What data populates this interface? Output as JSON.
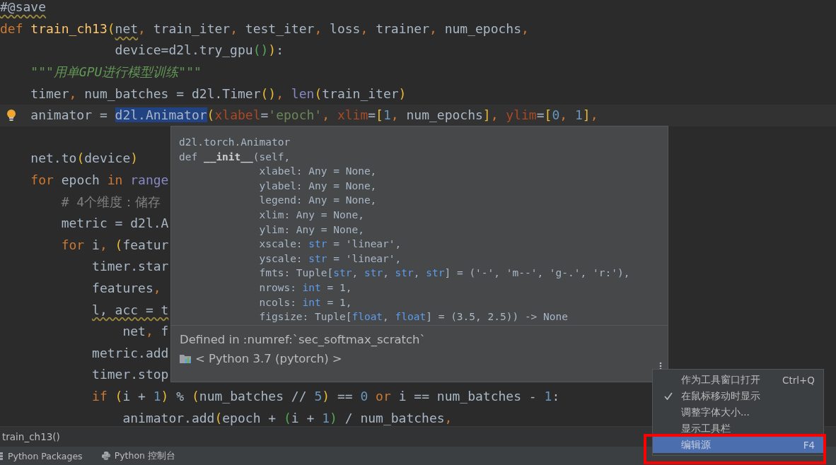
{
  "editor": {
    "lines": [
      {
        "current": false,
        "tokens": [
          {
            "kind": "w",
            "text": "#@save"
          }
        ]
      },
      {
        "current": false,
        "tokens": [
          {
            "kind": "kw",
            "text": "def "
          },
          {
            "kind": "fn",
            "text": "train_ch13"
          },
          {
            "kind": "y",
            "text": "("
          },
          {
            "kind": "w",
            "text": "net"
          },
          {
            "kind": "kw",
            "text": ", "
          },
          {
            "kind": "p",
            "text": "train_iter"
          },
          {
            "kind": "kw",
            "text": ", "
          },
          {
            "kind": "p",
            "text": "test_iter"
          },
          {
            "kind": "kw",
            "text": ", "
          },
          {
            "kind": "p",
            "text": "loss"
          },
          {
            "kind": "kw",
            "text": ", "
          },
          {
            "kind": "p",
            "text": "trainer"
          },
          {
            "kind": "kw",
            "text": ", "
          },
          {
            "kind": "p",
            "text": "num_epochs"
          },
          {
            "kind": "kw",
            "text": ","
          }
        ]
      },
      {
        "current": false,
        "tokens": [
          {
            "kind": "p",
            "text": "               device=d2l.try_gpu"
          },
          {
            "kind": "g",
            "text": "("
          },
          {
            "kind": "g",
            "text": ")"
          },
          {
            "kind": "y",
            "text": ")"
          },
          {
            "kind": "p",
            "text": ":"
          }
        ]
      },
      {
        "current": false,
        "tokens": [
          {
            "kind": "d",
            "text": "    \"\"\"用单GPU进行模型训练\"\"\""
          }
        ]
      },
      {
        "current": false,
        "tokens": [
          {
            "kind": "p",
            "text": "    timer"
          },
          {
            "kind": "kw",
            "text": ", "
          },
          {
            "kind": "p",
            "text": "num_batches = d2l.Timer"
          },
          {
            "kind": "y",
            "text": "()"
          },
          {
            "kind": "kw",
            "text": ", "
          },
          {
            "kind": "b",
            "text": "len"
          },
          {
            "kind": "y",
            "text": "("
          },
          {
            "kind": "p",
            "text": "train_iter"
          },
          {
            "kind": "y",
            "text": ")"
          }
        ]
      },
      {
        "current": true,
        "tokens": [
          {
            "kind": "p",
            "text": "    animator = "
          },
          {
            "kind": "sel",
            "text": "d2l.Animator"
          },
          {
            "kind": "y",
            "text": "("
          },
          {
            "kind": "a",
            "text": "xlabel"
          },
          {
            "kind": "p",
            "text": "="
          },
          {
            "kind": "s",
            "text": "'epoch'"
          },
          {
            "kind": "kw",
            "text": ", "
          },
          {
            "kind": "a",
            "text": "xlim"
          },
          {
            "kind": "p",
            "text": "="
          },
          {
            "kind": "y",
            "text": "["
          },
          {
            "kind": "n",
            "text": "1"
          },
          {
            "kind": "kw",
            "text": ", "
          },
          {
            "kind": "p",
            "text": "num_epochs"
          },
          {
            "kind": "y",
            "text": "]"
          },
          {
            "kind": "kw",
            "text": ", "
          },
          {
            "kind": "a",
            "text": "ylim"
          },
          {
            "kind": "p",
            "text": "="
          },
          {
            "kind": "y",
            "text": "["
          },
          {
            "kind": "n",
            "text": "0"
          },
          {
            "kind": "kw",
            "text": ", "
          },
          {
            "kind": "n",
            "text": "1"
          },
          {
            "kind": "y",
            "text": "]"
          },
          {
            "kind": "kw",
            "text": ","
          }
        ]
      },
      {
        "current": false
      },
      {
        "current": false,
        "tokens": [
          {
            "kind": "p",
            "text": "    net.to"
          },
          {
            "kind": "y",
            "text": "("
          },
          {
            "kind": "p",
            "text": "device"
          },
          {
            "kind": "y",
            "text": ")"
          }
        ]
      },
      {
        "current": false,
        "tokens": [
          {
            "kind": "kw",
            "text": "    for "
          },
          {
            "kind": "p",
            "text": "epoch "
          },
          {
            "kind": "kw",
            "text": "in "
          },
          {
            "kind": "b",
            "text": "range"
          }
        ]
      },
      {
        "current": false,
        "tokens": [
          {
            "kind": "c",
            "text": "        # 4个维度：储存"
          }
        ]
      },
      {
        "current": false,
        "tokens": [
          {
            "kind": "p",
            "text": "        metric = d2l.A"
          }
        ]
      },
      {
        "current": false,
        "tokens": [
          {
            "kind": "kw",
            "text": "        for "
          },
          {
            "kind": "p",
            "text": "i"
          },
          {
            "kind": "kw",
            "text": ", "
          },
          {
            "kind": "y",
            "text": "("
          },
          {
            "kind": "p",
            "text": "featur"
          }
        ]
      },
      {
        "current": false,
        "tokens": [
          {
            "kind": "p",
            "text": "            timer.star"
          }
        ]
      },
      {
        "current": false,
        "tokens": [
          {
            "kind": "p",
            "text": "            features"
          },
          {
            "kind": "kw",
            "text": ","
          }
        ]
      },
      {
        "current": false,
        "tokens": [
          {
            "kind": "w",
            "text": "            l, acc = t"
          }
        ]
      },
      {
        "current": false,
        "tokens": [
          {
            "kind": "p",
            "text": "                net"
          },
          {
            "kind": "kw",
            "text": ", "
          },
          {
            "kind": "p",
            "text": "f"
          }
        ]
      },
      {
        "current": false,
        "tokens": [
          {
            "kind": "p",
            "text": "            metric.add"
          }
        ]
      },
      {
        "current": false,
        "tokens": [
          {
            "kind": "p",
            "text": "            timer.stop"
          }
        ]
      },
      {
        "current": false,
        "tokens": [
          {
            "kind": "kw",
            "text": "            if "
          },
          {
            "kind": "y",
            "text": "("
          },
          {
            "kind": "p",
            "text": "i + "
          },
          {
            "kind": "n",
            "text": "1"
          },
          {
            "kind": "y",
            "text": ")"
          },
          {
            "kind": "p",
            "text": " % "
          },
          {
            "kind": "y",
            "text": "("
          },
          {
            "kind": "p",
            "text": "num_batches // "
          },
          {
            "kind": "n",
            "text": "5"
          },
          {
            "kind": "y",
            "text": ")"
          },
          {
            "kind": "p",
            "text": " == "
          },
          {
            "kind": "n",
            "text": "0"
          },
          {
            "kind": "kw",
            "text": " or "
          },
          {
            "kind": "p",
            "text": "i == num_batches - "
          },
          {
            "kind": "n",
            "text": "1"
          },
          {
            "kind": "p",
            "text": ":"
          }
        ]
      },
      {
        "current": false,
        "tokens": [
          {
            "kind": "p",
            "text": "                animator.add"
          },
          {
            "kind": "y",
            "text": "("
          },
          {
            "kind": "p",
            "text": "epoch + "
          },
          {
            "kind": "g",
            "text": "("
          },
          {
            "kind": "p",
            "text": "i + "
          },
          {
            "kind": "n",
            "text": "1"
          },
          {
            "kind": "g",
            "text": ")"
          },
          {
            "kind": "p",
            "text": " / num_batches"
          },
          {
            "kind": "kw",
            "text": ","
          }
        ]
      }
    ]
  },
  "quick_doc": {
    "signature": [
      [
        {
          "kind": "p",
          "text": "d2l.torch.Animator"
        }
      ],
      [
        {
          "kind": "p",
          "text": "def "
        },
        {
          "kind": "B",
          "text": "__init__"
        },
        {
          "kind": "p",
          "text": "(self,"
        }
      ],
      [
        {
          "kind": "p",
          "text": "             xlabel: Any = None,"
        }
      ],
      [
        {
          "kind": "p",
          "text": "             ylabel: Any = None,"
        }
      ],
      [
        {
          "kind": "p",
          "text": "             legend: Any = None,"
        }
      ],
      [
        {
          "kind": "p",
          "text": "             xlim: Any = None,"
        }
      ],
      [
        {
          "kind": "p",
          "text": "             ylim: Any = None,"
        }
      ],
      [
        {
          "kind": "p",
          "text": "             xscale: "
        },
        {
          "kind": "t",
          "text": "str"
        },
        {
          "kind": "p",
          "text": " = 'linear',"
        }
      ],
      [
        {
          "kind": "p",
          "text": "             yscale: "
        },
        {
          "kind": "t",
          "text": "str"
        },
        {
          "kind": "p",
          "text": " = 'linear',"
        }
      ],
      [
        {
          "kind": "p",
          "text": "             fmts: Tuple["
        },
        {
          "kind": "t",
          "text": "str"
        },
        {
          "kind": "p",
          "text": ", "
        },
        {
          "kind": "t",
          "text": "str"
        },
        {
          "kind": "p",
          "text": ", "
        },
        {
          "kind": "t",
          "text": "str"
        },
        {
          "kind": "p",
          "text": ", "
        },
        {
          "kind": "t",
          "text": "str"
        },
        {
          "kind": "p",
          "text": "] = ('-', 'm--', 'g-.', 'r:'),"
        }
      ],
      [
        {
          "kind": "p",
          "text": "             nrows: "
        },
        {
          "kind": "t",
          "text": "int"
        },
        {
          "kind": "p",
          "text": " = 1,"
        }
      ],
      [
        {
          "kind": "p",
          "text": "             ncols: "
        },
        {
          "kind": "t",
          "text": "int"
        },
        {
          "kind": "p",
          "text": " = 1,"
        }
      ],
      [
        {
          "kind": "p",
          "text": "             figsize: Tuple["
        },
        {
          "kind": "t",
          "text": "float"
        },
        {
          "kind": "p",
          "text": ", "
        },
        {
          "kind": "t",
          "text": "float"
        },
        {
          "kind": "p",
          "text": "] = (3.5, 2.5)) -> None"
        }
      ]
    ],
    "defined_in": "Defined in :numref:`sec_softmax_scratch`",
    "environment": "< Python 3.7 (pytorch) >"
  },
  "context_menu": {
    "items": [
      {
        "label": "作为工具窗口打开",
        "shortcut": "Ctrl+Q",
        "checked": false,
        "selected": false
      },
      {
        "label": "在鼠标移动时显示",
        "checked": true,
        "selected": false
      },
      {
        "label": "调整字体大小...",
        "checked": false,
        "selected": false
      },
      {
        "label": "显示工具栏",
        "checked": false,
        "selected": false
      },
      {
        "label": "编辑源",
        "shortcut": "F4",
        "checked": false,
        "selected": true
      }
    ]
  },
  "breadcrumb": "train_ch13()",
  "tool_tabs": [
    {
      "label": "Python Packages"
    },
    {
      "label": "Python 控制台"
    }
  ]
}
